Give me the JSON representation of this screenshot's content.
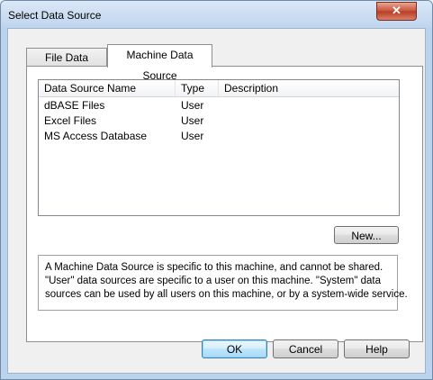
{
  "window": {
    "title": "Select Data Source",
    "close_glyph": "✕"
  },
  "tabs": [
    {
      "label": "File Data Source",
      "selected": false
    },
    {
      "label": "Machine Data Source",
      "selected": true
    }
  ],
  "list": {
    "columns": [
      "Data Source Name",
      "Type",
      "Description"
    ],
    "rows": [
      {
        "name": "dBASE Files",
        "type": "User",
        "description": ""
      },
      {
        "name": "Excel Files",
        "type": "User",
        "description": ""
      },
      {
        "name": "MS Access Database",
        "type": "User",
        "description": ""
      }
    ]
  },
  "new_button": "New...",
  "info_lines": [
    "A Machine Data Source is specific to this machine, and cannot be shared.",
    "\"User\" data sources are specific to a user on this machine.  \"System\" data",
    "sources can be used by all users on this machine, or by a system-wide service."
  ],
  "buttons": {
    "ok": "OK",
    "cancel": "Cancel",
    "help": "Help"
  },
  "colors": {
    "title_bar": "#bcd3ee",
    "close_button": "#c75037",
    "default_button_border": "#3c7fb1"
  }
}
